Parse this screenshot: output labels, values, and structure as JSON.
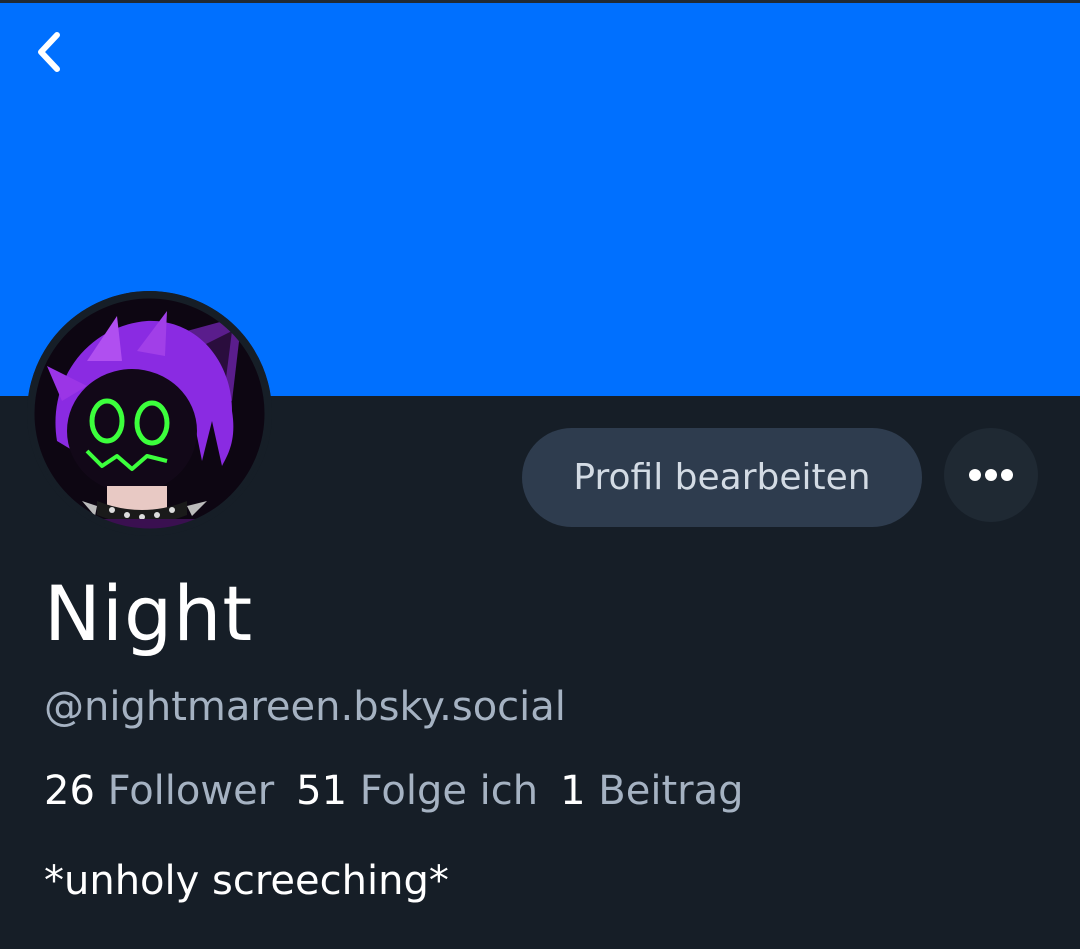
{
  "profile": {
    "display_name": "Night",
    "handle": "@nightmareen.bsky.social",
    "bio": "*unholy screeching*",
    "stats": {
      "followers_count": "26",
      "followers_label": "Follower",
      "following_count": "51",
      "following_label": "Folge ich",
      "posts_count": "1",
      "posts_label": "Beitrag"
    }
  },
  "actions": {
    "edit_profile_label": "Profil bearbeiten"
  },
  "icons": {
    "back": "chevron-left-icon",
    "more": "ellipsis-icon"
  },
  "colors": {
    "banner": "#0070ff",
    "background": "#161e27",
    "edit_button": "#2e3c4e",
    "secondary_text": "#a5b2c2",
    "avatar_eyes": "#3cff3c",
    "avatar_hair": "#8a2be2"
  }
}
